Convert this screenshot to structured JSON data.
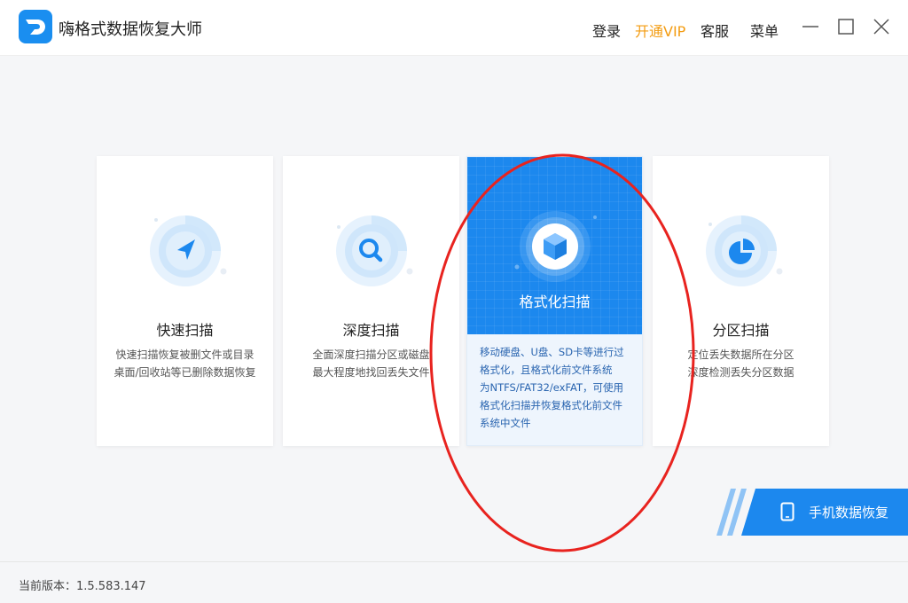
{
  "app": {
    "title": "嗨格式数据恢复大师"
  },
  "header": {
    "login_label": "登录",
    "vip_label": "开通VIP",
    "service_label": "客服",
    "menu_label": "菜单"
  },
  "colors": {
    "accent": "#1c88ee",
    "vip": "#f39c12",
    "annotation": "#e8231f"
  },
  "modes": [
    {
      "title": "快速扫描",
      "desc_lines": [
        "快速扫描恢复被删文件或目录",
        "桌面/回收站等已删除数据恢复"
      ],
      "icon": "navigation-arrow-icon"
    },
    {
      "title": "深度扫描",
      "desc_lines": [
        "全面深度扫描分区或磁盘",
        "最大程度地找回丢失文件"
      ],
      "icon": "magnifier-icon"
    },
    {
      "title": "格式化扫描",
      "desc_lines": [
        "移动硬盘、U盘、SD卡等进行过",
        "格式化，且格式化前文件系统",
        "为NTFS/FAT32/exFAT，可使用",
        "格式化扫描并恢复格式化前文件",
        "系统中文件"
      ],
      "icon": "cube-icon",
      "selected": true
    },
    {
      "title": "分区扫描",
      "desc_lines": [
        "定位丢失数据所在分区",
        "深度检测丢失分区数据"
      ],
      "icon": "pie-chart-icon"
    }
  ],
  "phone_recovery": {
    "label": "手机数据恢复",
    "icon": "mobile-phone-icon"
  },
  "footer": {
    "version_label": "当前版本：1.5.583.147"
  }
}
